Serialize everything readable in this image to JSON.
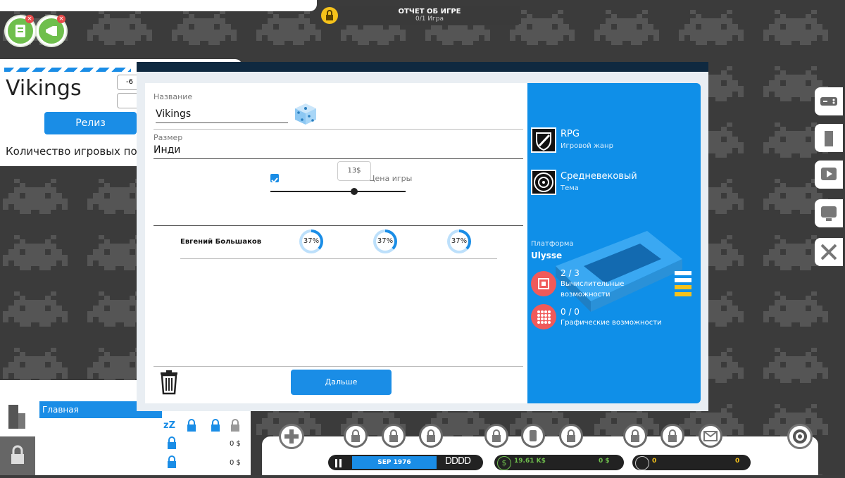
{
  "report": {
    "title": "ОТЧЕТ ОБ ИГРЕ",
    "subtitle": "0/1 Игра"
  },
  "top_icons": [
    {
      "name": "news-icon",
      "badge": "×"
    },
    {
      "name": "marketing-icon",
      "badge": "×"
    }
  ],
  "left_panel": {
    "game_title": "Vikings",
    "field1_value": "-6",
    "release_button": "Релиз",
    "ports_label": "Количество игровых порт"
  },
  "modal": {
    "name_label": "Название",
    "name_value": "Vikings",
    "size_label": "Размер",
    "size_value": "Инди",
    "price_tooltip": "13$",
    "price_label": "Цена игры",
    "price_checked": true,
    "price_slider_fraction": 0.62,
    "employee": {
      "name": "Евгений Большаков",
      "stats": [
        "37%",
        "37%",
        "37%"
      ],
      "fraction": 0.37
    },
    "next_button": "Дальше",
    "genre": {
      "title": "RPG",
      "subtitle": "Игровой жанр",
      "icon": "sword-shield-icon"
    },
    "theme": {
      "title": "Средневековый",
      "subtitle": "Тема",
      "icon": "medieval-shield-icon"
    },
    "platform_label": "Платформа",
    "platform_name": "Ulysse",
    "cpu": {
      "value": "2 / 3",
      "label_line1": "Вычислительные",
      "label_line2": "возможности"
    },
    "gpu": {
      "value": "0 / 0",
      "label": "Графические возможности"
    }
  },
  "lower_left": {
    "menu_item": "Главная",
    "zz": "zZ",
    "amount1": "0 $",
    "amount2": "0 $"
  },
  "bottom": {
    "date": "SEP  1976",
    "speed": "DDDD",
    "money": "19.61 K$",
    "money2": "0 $",
    "fans": "0",
    "fans2": "0"
  },
  "colors": {
    "accent": "#1a8de6",
    "sidebar": "#0f8fe8",
    "danger": "#f05a5a",
    "dark": "#0f2940"
  }
}
